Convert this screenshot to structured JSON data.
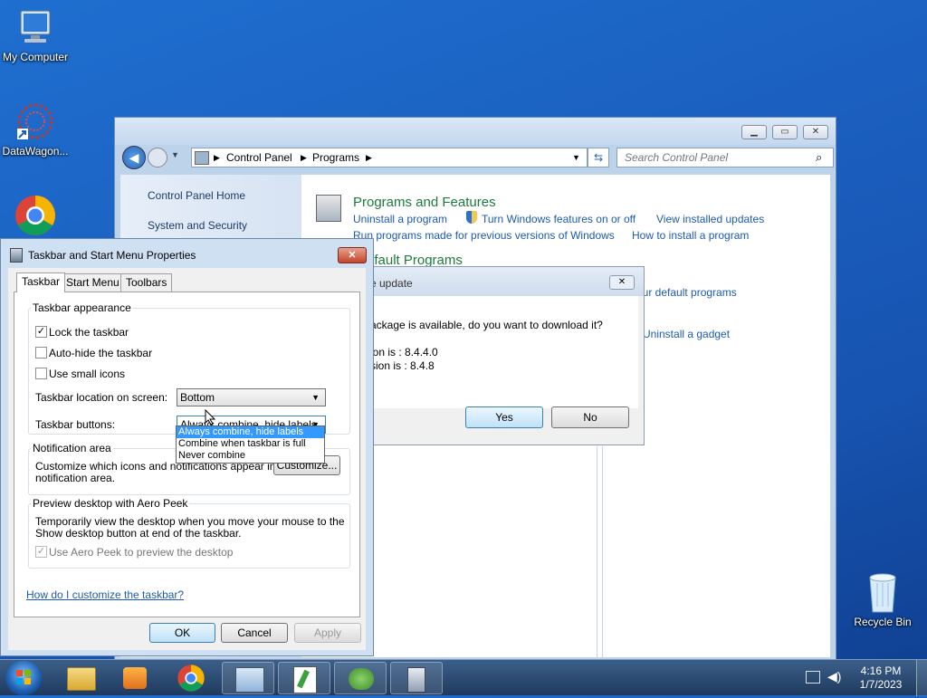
{
  "desktop": {
    "icons": [
      {
        "label": "My Computer"
      },
      {
        "label": "DataWagon..."
      },
      {
        "label": "Recycle Bin"
      }
    ]
  },
  "control_panel": {
    "breadcrumb": [
      "Control Panel",
      "Programs"
    ],
    "search_placeholder": "Search Control Panel",
    "left_links": [
      "Control Panel Home",
      "System and Security"
    ],
    "programs_and_features": {
      "heading": "Programs and Features",
      "links": [
        "Uninstall a program",
        "Turn Windows features on or off",
        "View installed updates",
        "Run programs made for previous versions of Windows",
        "How to install a program"
      ]
    },
    "default_programs": {
      "heading": "efault Programs",
      "link": "our default programs"
    },
    "gadget_link": "Uninstall a gadget"
  },
  "update_dialog": {
    "title": "e update",
    "message": "ackage is available, do you want to download it?",
    "line1": "ion is   : 8.4.4.0",
    "line2": "sion is : 8.4.8",
    "yes": "Yes",
    "no": "No"
  },
  "taskbar_props": {
    "title": "Taskbar and Start Menu Properties",
    "tabs": [
      "Taskbar",
      "Start Menu",
      "Toolbars"
    ],
    "appearance": {
      "label": "Taskbar appearance",
      "lock": {
        "label": "Lock the taskbar",
        "checked": true
      },
      "autohide": {
        "label": "Auto-hide the taskbar",
        "checked": false
      },
      "small": {
        "label": "Use small icons",
        "checked": false
      },
      "location_label": "Taskbar location on screen:",
      "location_value": "Bottom",
      "buttons_label": "Taskbar buttons:",
      "buttons_value": "Always combine, hide labels",
      "buttons_options": [
        "Always combine, hide labels",
        "Combine when taskbar is full",
        "Never combine"
      ]
    },
    "notification": {
      "label": "Notification area",
      "text1": "Customize which icons and notifications appear in the",
      "text2": "notification area.",
      "button": "Customize..."
    },
    "aero": {
      "label": "Preview desktop with Aero Peek",
      "text1": "Temporarily view the desktop when you move your mouse to the",
      "text2": "Show desktop button at end of the taskbar.",
      "check": "Use Aero Peek to preview the desktop"
    },
    "help_link": "How do I customize the taskbar?",
    "ok": "OK",
    "cancel": "Cancel",
    "apply": "Apply"
  },
  "taskbar": {
    "time": "4:16 PM",
    "date": "1/7/2023"
  }
}
